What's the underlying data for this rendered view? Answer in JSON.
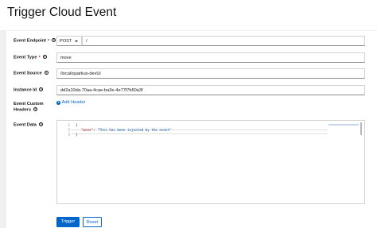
{
  "page": {
    "title": "Trigger Cloud Event"
  },
  "form": {
    "endpoint": {
      "label": "Event Endpoint",
      "required": "*",
      "method": "POST",
      "path": "/"
    },
    "event_type": {
      "label": "Event Type",
      "required": "*",
      "value": "move"
    },
    "event_source": {
      "label": "Event Source",
      "value": "/local/quarkus-devUi"
    },
    "instance_id": {
      "label": "Instance Id",
      "value": "dd2a10da-70aa-4cae-ba3e-4e77f7b50a3f"
    },
    "custom_headers": {
      "label_line1": "Event Custom",
      "label_line2": "Headers",
      "add_label": "Add Header"
    },
    "event_data": {
      "label": "Event Data",
      "line_numbers": [
        "1",
        "2",
        "3"
      ],
      "lines": [
        "{",
        "\"move\": \"This has been injected by the event\"",
        "}"
      ],
      "key": "\"move\"",
      "colon": ": ",
      "string": "\"This has been injected by the event\""
    }
  },
  "actions": {
    "trigger": "Trigger",
    "reset": "Reset"
  },
  "icons": {
    "help": "help-icon",
    "add": "plus-circle-icon",
    "caret": "caret-down-icon"
  },
  "colors": {
    "accent": "#0066cc",
    "required": "#c9190b",
    "background": "#f0f0f0"
  }
}
